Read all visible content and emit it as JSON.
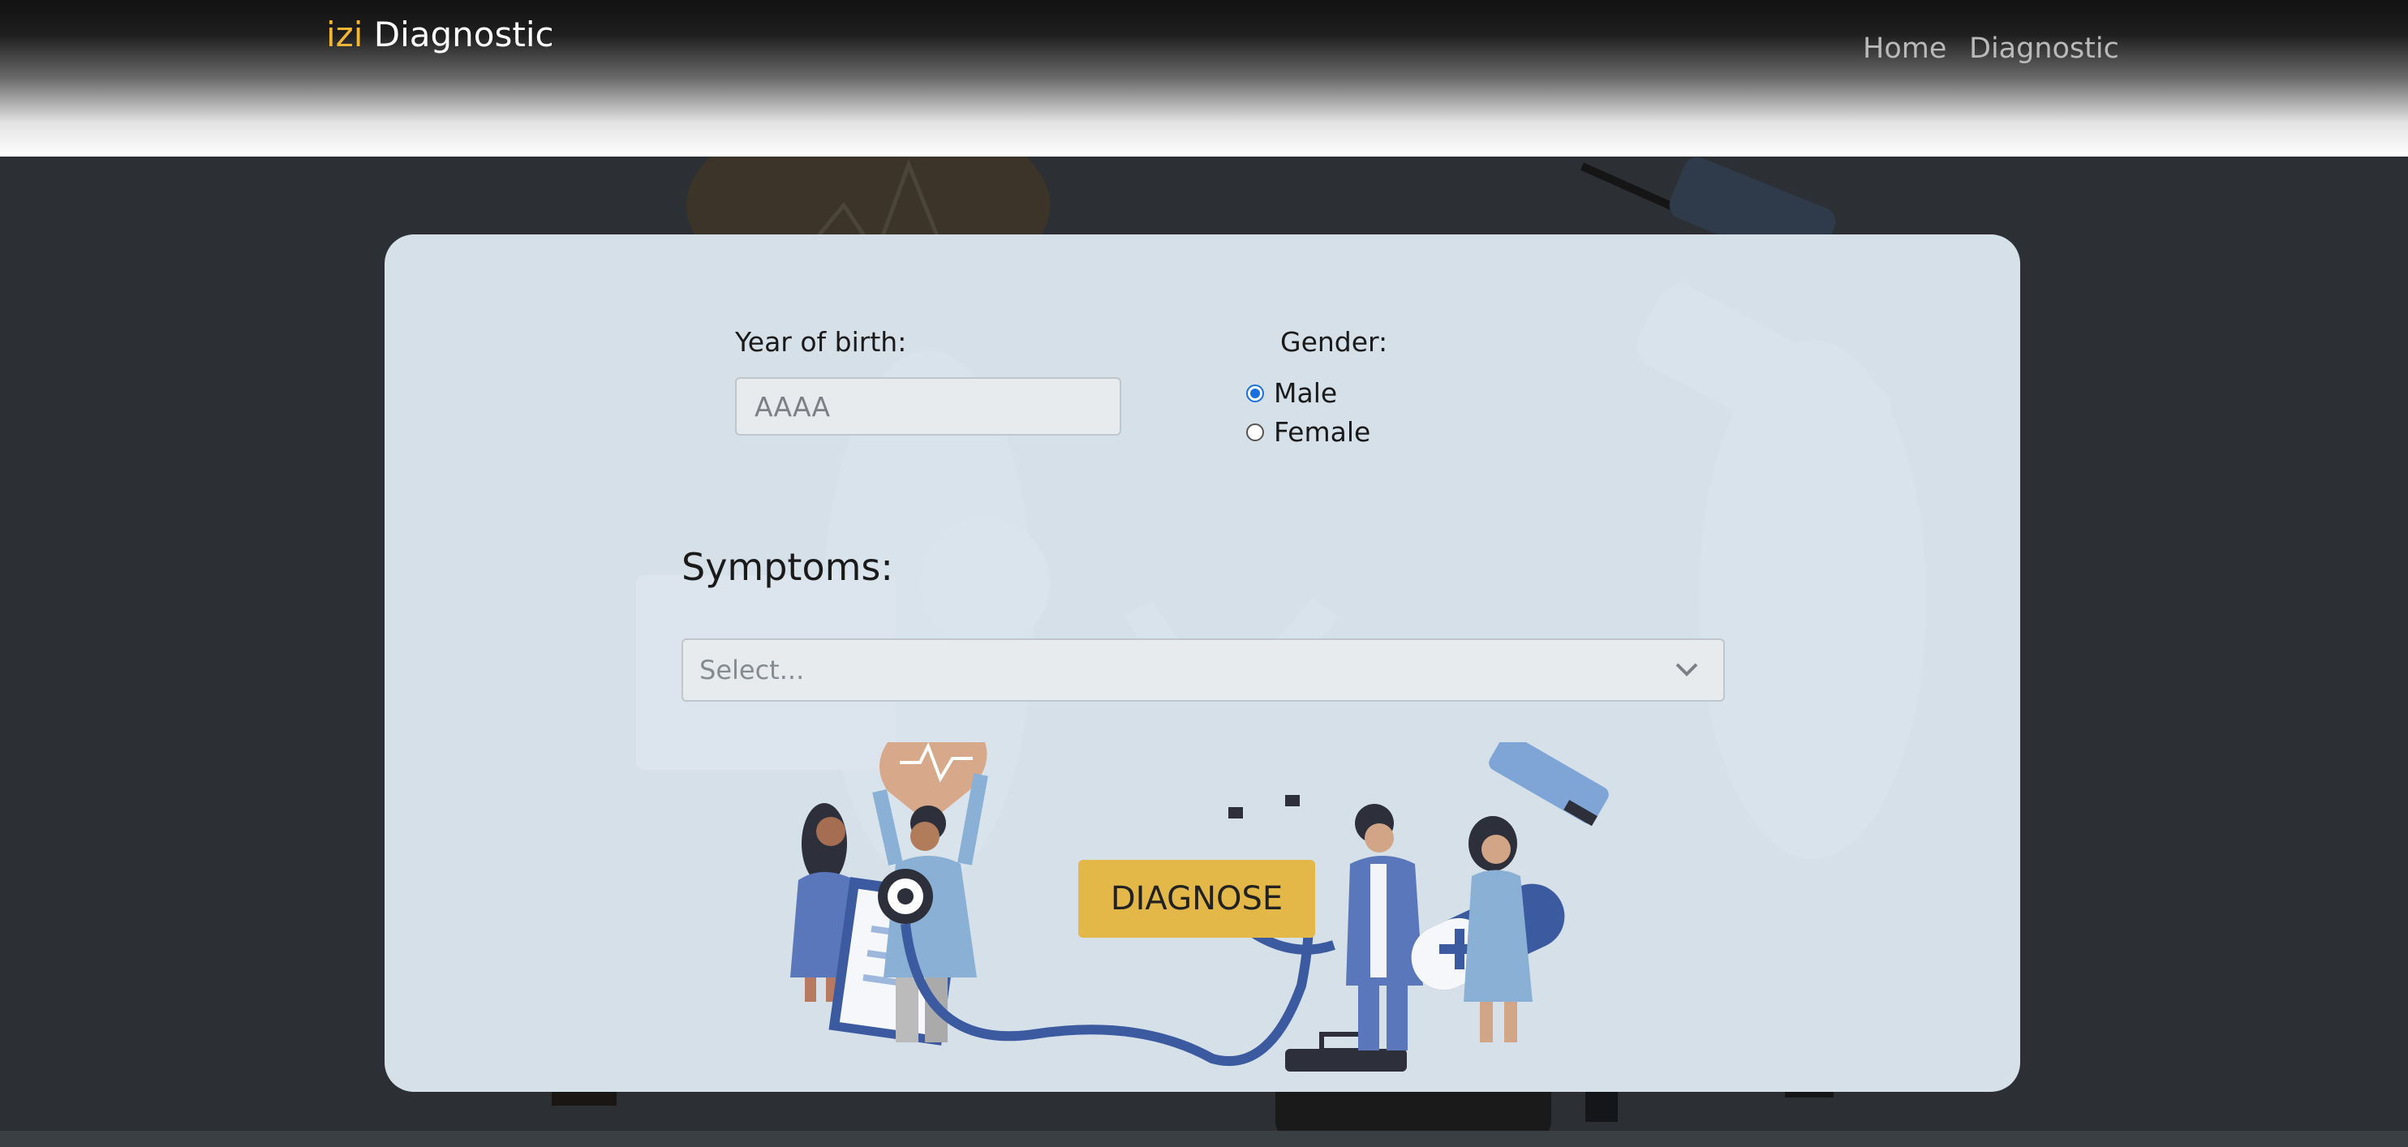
{
  "navbar": {
    "brand_accent": "izi",
    "brand_name": "Diagnostic",
    "links": [
      "Home",
      "Diagnostic"
    ]
  },
  "form": {
    "year_label": "Year of birth:",
    "year_placeholder": "AAAA",
    "year_value": "",
    "gender_label": "Gender:",
    "gender_options": [
      "Male",
      "Female"
    ],
    "gender_selected": "Male",
    "symptoms_label": "Symptoms:",
    "symptoms_placeholder": "Select...",
    "submit_label": "DIAGNOSE"
  },
  "colors": {
    "brand_accent": "#f2b632",
    "card_background": "#d5e0e9",
    "button_background": "#e3b849",
    "page_background": "#2c3034"
  }
}
